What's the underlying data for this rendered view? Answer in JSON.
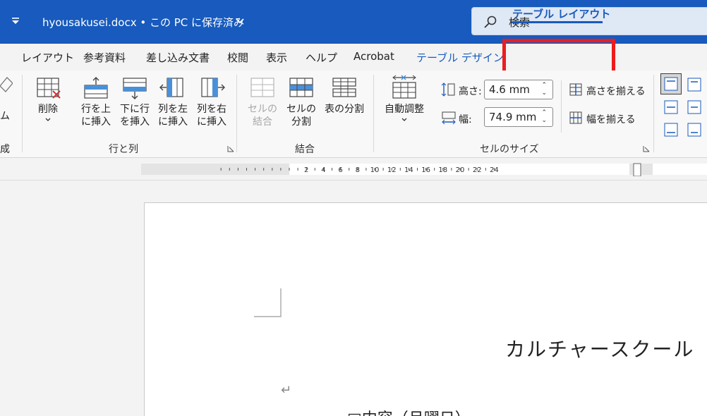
{
  "titlebar": {
    "document_title": "hyousakusei.docx • この PC に保存済み",
    "search_placeholder": "検索"
  },
  "tabs": [
    {
      "label": "レイアウト"
    },
    {
      "label": "参考資料"
    },
    {
      "label": "差し込み文書"
    },
    {
      "label": "校閲"
    },
    {
      "label": "表示"
    },
    {
      "label": "ヘルプ"
    },
    {
      "label": "Acrobat"
    },
    {
      "label": "テーブル デザイン"
    },
    {
      "label": "テーブル レイアウト",
      "active": true
    }
  ],
  "ribbon": {
    "partial_left": {
      "label1": "ム",
      "label2": "成"
    },
    "rows_columns": {
      "group_label": "行と列",
      "delete_label": "削除",
      "insert_above_line1": "行を上",
      "insert_above_line2": "に挿入",
      "insert_below_line1": "下に行",
      "insert_below_line2": "を挿入",
      "insert_left_line1": "列を左",
      "insert_left_line2": "に挿入",
      "insert_right_line1": "列を右",
      "insert_right_line2": "に挿入"
    },
    "merge": {
      "group_label": "結合",
      "merge_cells_line1": "セルの",
      "merge_cells_line2": "結合",
      "split_cells_line1": "セルの",
      "split_cells_line2": "分割",
      "split_table": "表の分割"
    },
    "cell_size": {
      "group_label": "セルのサイズ",
      "autofit": "自動調整",
      "height_label": "高さ:",
      "height_value": "4.6 mm",
      "width_label": "幅:",
      "width_value": "74.9 mm",
      "distribute_rows": "高さを揃える",
      "distribute_columns": "幅を揃える"
    }
  },
  "ruler": {
    "labels": [
      "2",
      "4",
      "6",
      "8",
      "10",
      "12",
      "14",
      "16",
      "18",
      "20",
      "22",
      "24"
    ]
  },
  "document": {
    "title": "カルチャースクール",
    "line2": "□内容（月曜日）"
  },
  "colors": {
    "accent": "#185abd",
    "highlight": "#ee1c1c"
  }
}
